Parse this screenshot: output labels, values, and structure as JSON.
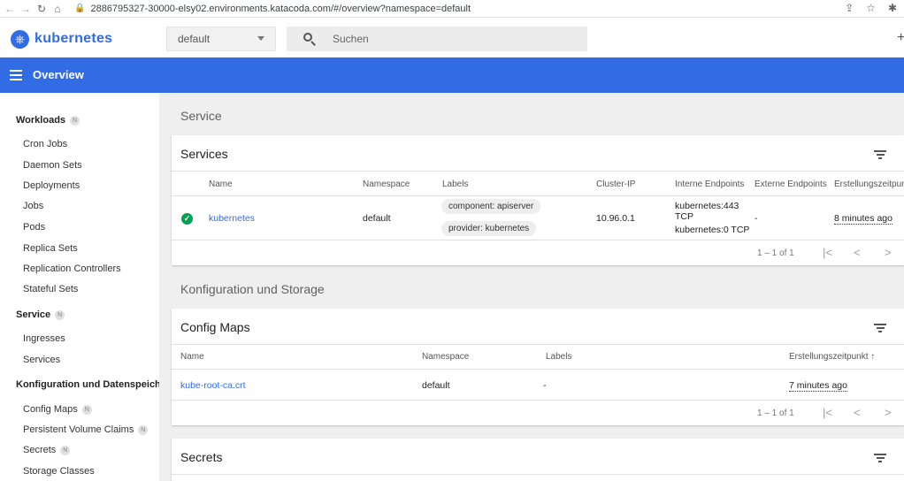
{
  "browser": {
    "url": "2886795327-30000-elsy02.environments.katacoda.com/#/overview?namespace=default"
  },
  "header": {
    "brand": "kubernetes",
    "namespace": "default",
    "search_placeholder": "Suchen"
  },
  "toolbar": {
    "title": "Overview"
  },
  "sidebar": {
    "workloads": {
      "label": "Workloads",
      "badge": "N"
    },
    "workload_items": [
      "Cron Jobs",
      "Daemon Sets",
      "Deployments",
      "Jobs",
      "Pods",
      "Replica Sets",
      "Replication Controllers",
      "Stateful Sets"
    ],
    "service": {
      "label": "Service",
      "badge": "N"
    },
    "service_items": [
      "Ingresses",
      "Services"
    ],
    "config": {
      "label": "Konfiguration und Datenspeicherung"
    },
    "config_items": [
      {
        "label": "Config Maps",
        "badge": "N"
      },
      {
        "label": "Persistent Volume Claims",
        "badge": "N"
      },
      {
        "label": "Secrets",
        "badge": "N"
      },
      {
        "label": "Storage Classes",
        "badge": ""
      }
    ]
  },
  "main": {
    "service_section": "Service",
    "services_card": {
      "title": "Services",
      "headers": [
        "Name",
        "Namespace",
        "Labels",
        "Cluster-IP",
        "Interne Endpoints",
        "Externe Endpoints",
        "Erstellungszeitpunkt"
      ],
      "row": {
        "name": "kubernetes",
        "namespace": "default",
        "labels": [
          "component: apiserver",
          "provider: kubernetes"
        ],
        "cluster_ip": "10.96.0.1",
        "internal_endpoint_1a": "kubernetes:443",
        "internal_endpoint_1b": "TCP",
        "internal_endpoint_2": "kubernetes:0 TCP",
        "external_endpoints": "-",
        "created": "8 minutes ago"
      },
      "pager": "1 – 1 of 1"
    },
    "config_section": "Konfiguration und Storage",
    "configmaps_card": {
      "title": "Config Maps",
      "headers": [
        "Name",
        "Namespace",
        "Labels",
        "Erstellungszeitpunkt"
      ],
      "sort_indicator": "↑",
      "row": {
        "name": "kube-root-ca.crt",
        "namespace": "default",
        "labels": "-",
        "created": "7 minutes ago"
      },
      "pager": "1 – 1 of 1"
    },
    "secrets_card": {
      "title": "Secrets"
    }
  }
}
